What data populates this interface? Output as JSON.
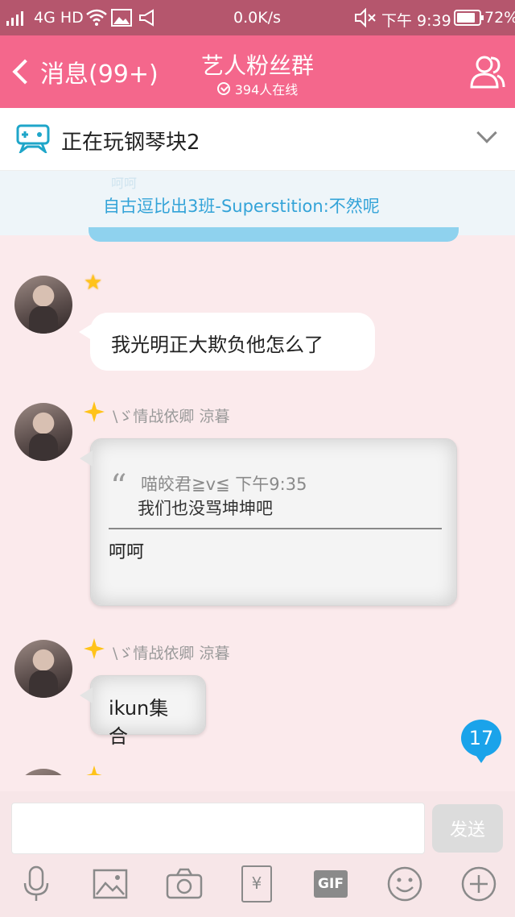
{
  "status_bar": {
    "network": "4G HD",
    "speed": "0.0K/s",
    "time": "下午 9:39",
    "battery": "72%"
  },
  "header": {
    "back_label": "消息(99+)",
    "title": "艺人粉丝群",
    "online": "394人在线"
  },
  "game_bar": {
    "text": "正在玩钢琴块2"
  },
  "banner": {
    "ghost_text": "呵呵",
    "text": "自古逗比出3班-Superstition:不然呢"
  },
  "messages": [
    {
      "text": "我光明正大欺负他怎么了"
    },
    {
      "sender": "\\ゞ情战依卿 涼暮",
      "quote_author": "喵皎君≧v≦ 下午9:35",
      "quote_text": "我们也没骂坤坤吧",
      "text": "呵呵"
    },
    {
      "sender": "\\ゞ情战依卿 涼暮",
      "text": "ikun集合"
    }
  ],
  "unread_badge": "17",
  "input": {
    "placeholder": "",
    "send_label": "发送"
  },
  "toolbar": {
    "gif_label": "GIF",
    "redpacket_label": "¥"
  },
  "colors": {
    "status_bar": "#b5566d",
    "header": "#f4678c",
    "chat_bg": "#fbeaec",
    "accent_blue": "#1aa3ea",
    "banner_text": "#33a3d8"
  }
}
